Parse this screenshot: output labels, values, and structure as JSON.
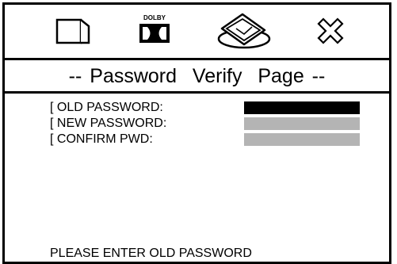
{
  "icon_bar": {
    "icons": [
      {
        "name": "page-icon"
      },
      {
        "name": "dolby-icon",
        "text": "DOLBY"
      },
      {
        "name": "setup-disc-icon"
      },
      {
        "name": "exit-icon"
      }
    ]
  },
  "page": {
    "title": "-- Password  Verify  Page --"
  },
  "form": {
    "fields": [
      {
        "label": "[ OLD PASSWORD:",
        "state": "selected"
      },
      {
        "label": "[ NEW PASSWORD:",
        "state": "inactive"
      },
      {
        "label": "[ CONFIRM PWD:",
        "state": "inactive"
      }
    ]
  },
  "status": {
    "message": "PLEASE ENTER OLD PASSWORD"
  },
  "colors": {
    "selected_field": "#000000",
    "inactive_field": "#b4b4b4"
  }
}
